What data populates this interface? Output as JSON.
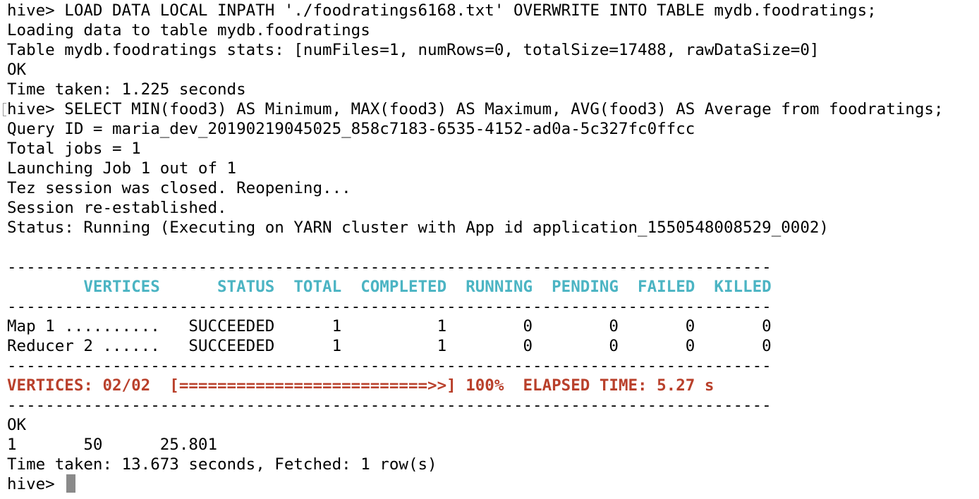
{
  "terminal": {
    "lines": [
      "hive> LOAD DATA LOCAL INPATH './foodratings6168.txt' OVERWRITE INTO TABLE mydb.foodratings;",
      "Loading data to table mydb.foodratings",
      "Table mydb.foodratings stats: [numFiles=1, numRows=0, totalSize=17488, rawDataSize=0]",
      "OK",
      "Time taken: 1.225 seconds",
      "hive> SELECT MIN(food3) AS Minimum, MAX(food3) AS Maximum, AVG(food3) AS Average from foodratings;",
      "Query ID = maria_dev_20190219045025_858c7183-6535-4152-ad0a-5c327fc0ffcc",
      "Total jobs = 1",
      "Launching Job 1 out of 1",
      "Tez session was closed. Reopening...",
      "Session re-established.",
      "Status: Running (Executing on YARN cluster with App id application_1550548008529_0002)",
      "",
      "--------------------------------------------------------------------------------",
      "        VERTICES      STATUS  TOTAL  COMPLETED  RUNNING  PENDING  FAILED  KILLED",
      "--------------------------------------------------------------------------------",
      "Map 1 ..........   SUCCEEDED      1          1        0        0       0       0",
      "Reducer 2 ......   SUCCEEDED      1          1        0        0       0       0",
      "--------------------------------------------------------------------------------",
      "VERTICES: 02/02  [==========================>>] 100%  ELAPSED TIME: 5.27 s",
      "--------------------------------------------------------------------------------",
      "OK",
      "1       50      25.801",
      "Time taken: 13.673 seconds, Fetched: 1 row(s)",
      "hive> "
    ]
  },
  "colors": {
    "background": "#ffffff",
    "text": "#000000",
    "table_header": "#4bb4c3",
    "progress_summary": "#b9402b",
    "cursor": "#8a8a8a"
  }
}
